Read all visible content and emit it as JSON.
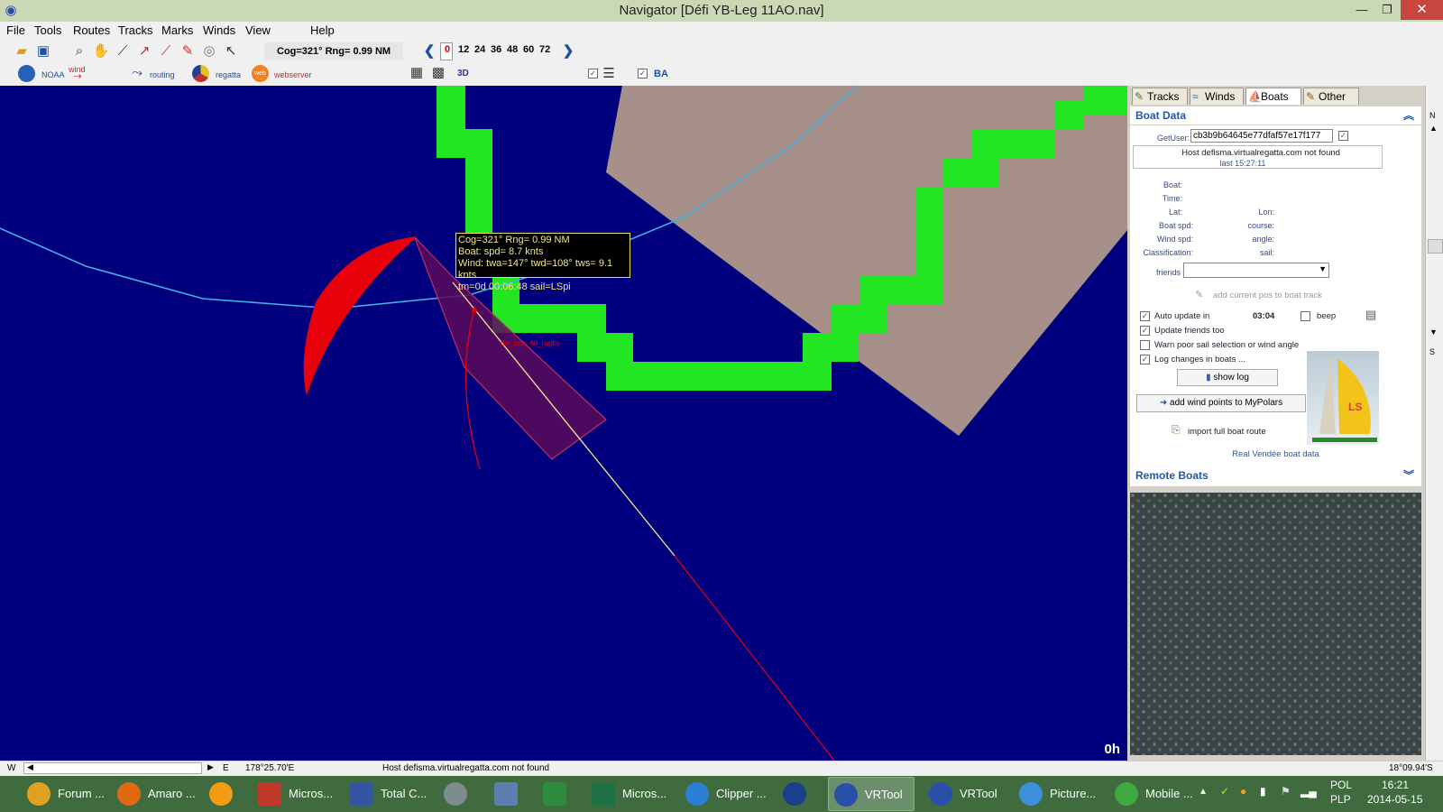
{
  "window": {
    "title": "Navigator [Défi YB-Leg 11AO.nav]",
    "minimize": "—",
    "restore": "❐",
    "close": "✕"
  },
  "menu": [
    "File",
    "Tools",
    "Routes",
    "Tracks",
    "Marks",
    "Winds",
    "View",
    "Help"
  ],
  "toolbar": {
    "readout": "Cog=321° Rng=  0.99 NM",
    "hours": [
      "0",
      "12",
      "24",
      "36",
      "48",
      "60",
      "72"
    ],
    "selected_hour": "0"
  },
  "toolbar2": {
    "noaa": "NOAA",
    "wind": "wind",
    "routing": "routing",
    "regatta": "regatta",
    "web_icon": "web",
    "webserver": "webserver",
    "three_d": "3D",
    "ba": "BA"
  },
  "map": {
    "tooltip": [
      "Cog=321° Rng=  0.99 NM",
      "Boat: spd= 8.7 knts",
      "Wind: twa=147° twd=108° tws= 9.1 knts",
      "tm=0d 00:06:48 sail=LSpi"
    ],
    "boat_label": "ow_bob_60_rugby",
    "time_label": "0h",
    "colors": {
      "sea": "#00007f",
      "land": "#a8908a",
      "grid": "#22e622",
      "sail": "#e8000a",
      "track": "#3fb0e0"
    }
  },
  "panel": {
    "tabs": [
      "Tracks",
      "Winds",
      "Boats",
      "Other"
    ],
    "active_tab": "Boats",
    "boat_data": {
      "header": "Boat Data",
      "getuser_label": "GetUser:",
      "getuser_value": "cb3b9b64645e77dfaf57e17f177",
      "host_msg": "Host defisma.virtualregatta.com not found",
      "last": "last 15:27:11",
      "fields": {
        "boat": "Boat:",
        "time": "Time:",
        "lat": "Lat:",
        "lon": "Lon:",
        "boat_spd": "Boat spd:",
        "course": "course:",
        "wind_spd": "Wind  spd:",
        "angle": "angle:",
        "classification": "Classification:",
        "sail": "sail:"
      },
      "friends_label": "friends",
      "add_pos": "add current pos to boat track",
      "auto_update": "Auto update in",
      "countdown": "03:04",
      "beep": "beep",
      "update_friends": "Update friends too",
      "warn_poor": "Warn poor sail selection or wind angle",
      "log_changes": "Log changes in boats ...",
      "show_log": "show log",
      "add_wind": "add wind points to MyPolars",
      "import_route": "import full boat route",
      "real_vendee": "Real Vendée boat data",
      "sail_logo": "LS"
    },
    "remote_boats": "Remote Boats"
  },
  "scrollbar": {
    "n": "N",
    "s": "S"
  },
  "statusbar": {
    "w": "W",
    "e": "E",
    "lon": "178°25.70'E",
    "msg": "Host defisma.virtualregatta.com not found",
    "lat": "18°09.94'S"
  },
  "taskbar": {
    "items": [
      {
        "label": "Forum ...",
        "color": "#e0a020"
      },
      {
        "label": "Amaro ...",
        "color": "#e06a10"
      },
      {
        "label": "",
        "color": "#f39c12"
      },
      {
        "label": "Micros...",
        "color": "#c0392b"
      },
      {
        "label": "Total C...",
        "color": "#3455a4"
      },
      {
        "label": "",
        "color": "#7f8c8d"
      },
      {
        "label": "",
        "color": "#5d7fb0"
      },
      {
        "label": "",
        "color": "#2e8b3e"
      },
      {
        "label": "Micros...",
        "color": "#1e7145"
      },
      {
        "label": "Clipper ...",
        "color": "#2a7fd4"
      },
      {
        "label": "",
        "color": "#1b3f8c"
      },
      {
        "label": "VRTool",
        "color": "#2a4fa8"
      },
      {
        "label": "VRTool",
        "color": "#2a4fa8"
      },
      {
        "label": "Picture...",
        "color": "#3d8fd8"
      },
      {
        "label": "Mobile ...",
        "color": "#3fa83f"
      }
    ],
    "lang": "POL",
    "layout": "PLP",
    "time": "16:21",
    "date": "2014-05-15"
  }
}
